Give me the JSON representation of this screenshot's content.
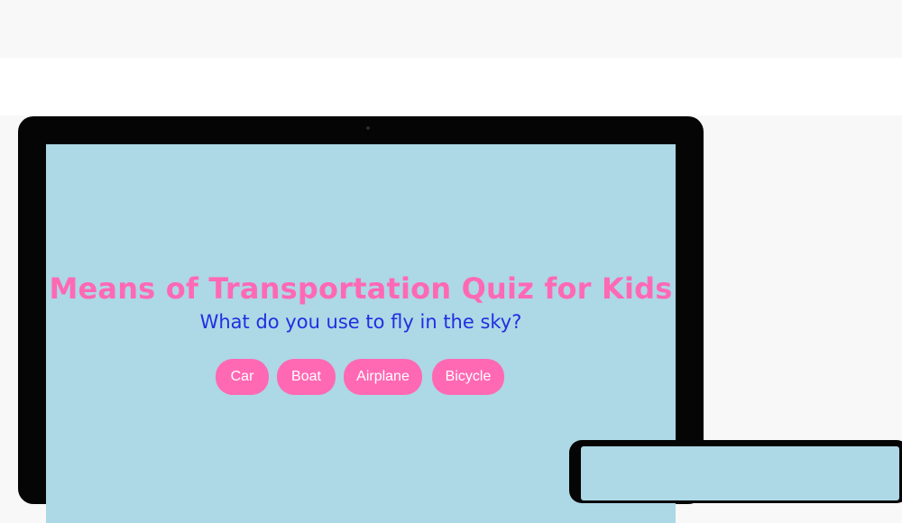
{
  "quiz": {
    "title": "Means of Transportation Quiz for Kids",
    "question": "What do you use to fly in the sky?",
    "answers": [
      "Car",
      "Boat",
      "Airplane",
      "Bicycle"
    ]
  },
  "colors": {
    "page_background": "#f8f8f8",
    "top_white_band": "#ffffff",
    "device_frame": "#050505",
    "screen_background": "#add8e6",
    "title_text": "#ff69b4",
    "question_text": "#1f2fe0",
    "button_background": "#ff69b4",
    "button_text": "#ffffff"
  }
}
